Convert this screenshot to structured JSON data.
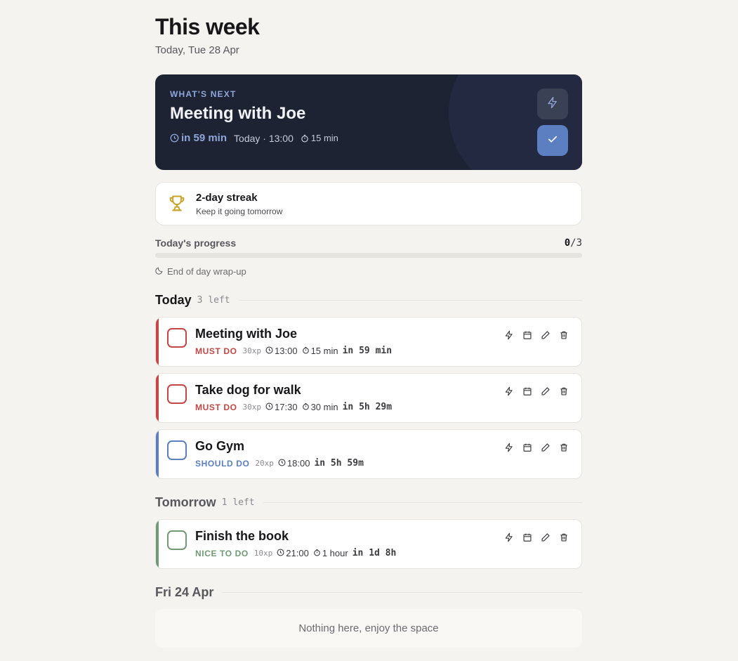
{
  "header": {
    "title": "This week",
    "subtitle": "Today, Tue 28 Apr"
  },
  "next_up": {
    "label": "WHAT'S NEXT",
    "title": "Meeting with Joe",
    "relative": "in 59 min",
    "when": "Today · 13:00",
    "duration": "15 min"
  },
  "streak": {
    "title": "2-day streak",
    "subtitle": "Keep it going tomorrow"
  },
  "progress": {
    "label": "Today's progress",
    "done": "0",
    "total": "/3",
    "fraction": 0.0
  },
  "wrapup": {
    "label": "End of day wrap-up"
  },
  "sections": {
    "today": {
      "name": "Today",
      "left": "3 left"
    },
    "tomorrow": {
      "name": "Tomorrow",
      "left": "1 left"
    },
    "fri": {
      "name": "Fri 24 Apr",
      "empty": "Nothing here, enjoy the space"
    }
  },
  "tasks": [
    {
      "title": "Meeting with Joe",
      "priority": "MUST DO",
      "xp": "30xp",
      "time": "13:00",
      "duration": "15 min",
      "relative": "in 59 min"
    },
    {
      "title": "Take dog for walk",
      "priority": "MUST DO",
      "xp": "30xp",
      "time": "17:30",
      "duration": "30 min",
      "relative": "in 5h 29m"
    },
    {
      "title": "Go Gym",
      "priority": "SHOULD DO",
      "xp": "20xp",
      "time": "18:00",
      "duration": "",
      "relative": "in 5h 59m"
    },
    {
      "title": "Finish the book",
      "priority": "NICE TO DO",
      "xp": "10xp",
      "time": "21:00",
      "duration": "1 hour",
      "relative": "in 1d 8h"
    }
  ],
  "colors": {
    "must": "#c94545",
    "should": "#5b7fc1",
    "nice": "#6f9a73",
    "accent": "#5b7fc1",
    "trophy": "#c9a227"
  },
  "icons": [
    "clock-icon",
    "timer-icon",
    "lightning-icon",
    "check-icon",
    "trophy-icon",
    "moon-icon",
    "calendar-icon",
    "pencil-icon",
    "trash-icon"
  ]
}
